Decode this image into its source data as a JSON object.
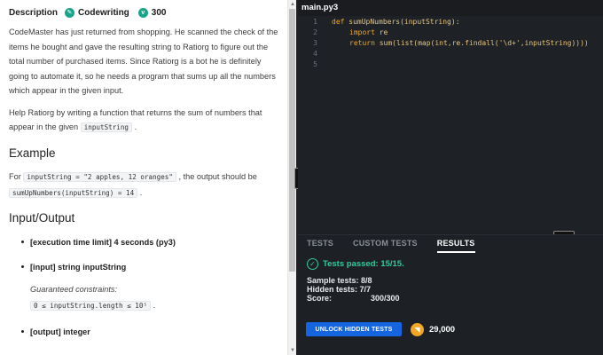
{
  "header": {
    "description_tab": "Description",
    "category": "Codewriting",
    "score": "300"
  },
  "description": {
    "p1": "CodeMaster has just returned from shopping. He scanned the check of the items he bought and gave the resulting string to Ratiorg to figure out the total number of purchased items. Since Ratiorg is a bot he is definitely going to automate it, so he needs a program that sums up all the numbers which appear in the given input.",
    "p2_text": "Help Ratiorg by writing a function that returns the sum of numbers that appear in the given",
    "p2_code": "inputString",
    "p2_end": "."
  },
  "example": {
    "heading": "Example",
    "for": "For",
    "code1": "inputString = \"2 apples, 12 oranges\"",
    "mid": ", the output should be",
    "code2": "sumUpNumbers(inputString) = 14",
    "end": "."
  },
  "io": {
    "heading": "Input/Output",
    "item1": "[execution time limit] 4 seconds (py3)",
    "item2": "[input] string inputString",
    "constraints_label": "Guaranteed constraints:",
    "constraint_code": "0 ≤ inputString.length ≤ 10⁵",
    "constraint_end": ".",
    "item3": "[output] integer"
  },
  "editor": {
    "file_tab": "main.py3",
    "line_numbers": [
      "1",
      "2",
      "3",
      "4",
      "5"
    ],
    "line1": {
      "kw": "def",
      "fn": "sumUpNumbers",
      "rest": "(inputString):"
    },
    "line2": {
      "kw": "import",
      "rest": "re"
    },
    "line3": {
      "kw": "return",
      "rest_a": "sum(list(map(int,re.findall(",
      "str": "'\\d+'",
      "rest_b": ",inputString))))"
    }
  },
  "results": {
    "tabs": [
      "TESTS",
      "CUSTOM TESTS",
      "RESULTS"
    ],
    "passed": "Tests passed: 15/15.",
    "sample_label": "Sample tests:",
    "sample_value": "8/8",
    "hidden_label": "Hidden tests:",
    "hidden_value": "7/7",
    "score_label": "Score:",
    "score_value": "300/300",
    "unlock_button": "UNLOCK HIDDEN TESTS",
    "coins": "29,000"
  },
  "colors": {
    "accent_green": "#2ecc9a",
    "button_blue": "#1565e0",
    "coin_orange": "#f5a623",
    "editor_bg": "#1e2126"
  }
}
